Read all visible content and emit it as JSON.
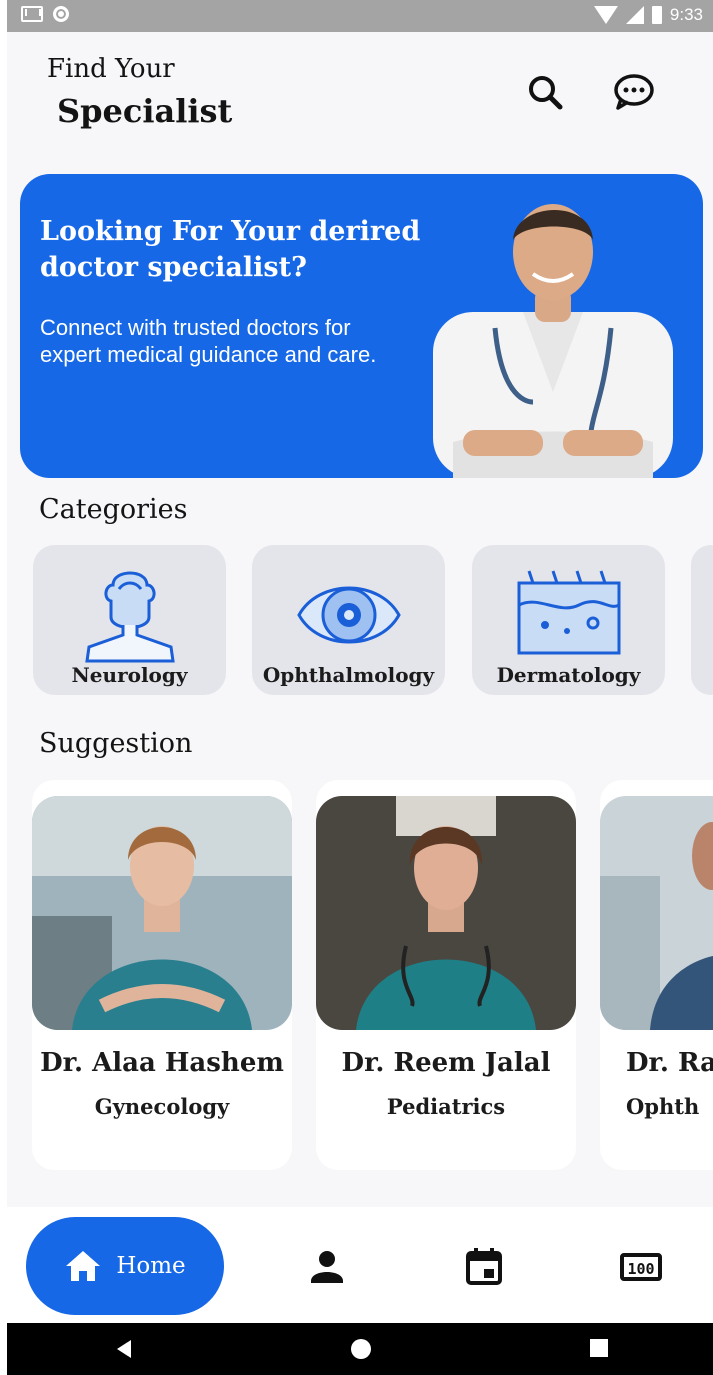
{
  "status_bar": {
    "time": "9:33",
    "icons": [
      "gmail-icon",
      "notification-circle-icon",
      "wifi-icon",
      "signal-icon",
      "battery-icon"
    ]
  },
  "header": {
    "line1": "Find Your",
    "line2": "Specialist",
    "icons": [
      "search-icon",
      "chat-icon"
    ]
  },
  "banner": {
    "title": "Looking For Your derired doctor specialist?",
    "subtitle": "Connect with trusted doctors for expert medical guidance and care."
  },
  "categories": {
    "title": "Categories",
    "items": [
      {
        "label": "Neurology",
        "icon": "brain-head-icon"
      },
      {
        "label": "Ophthalmology",
        "icon": "eye-icon"
      },
      {
        "label": "Dermatology",
        "icon": "skin-layers-icon"
      }
    ]
  },
  "suggestion": {
    "title": "Suggestion",
    "doctors": [
      {
        "name": "Dr. Alaa Hashem",
        "specialty": "Gynecology"
      },
      {
        "name": "Dr. Reem Jalal",
        "specialty": "Pediatrics"
      },
      {
        "name": "Dr. Ra",
        "specialty": "Ophth"
      }
    ]
  },
  "bottom_nav": {
    "home_label": "Home",
    "items": [
      "home-icon",
      "profile-icon",
      "calendar-icon",
      "counter-icon"
    ]
  },
  "colors": {
    "primary": "#1668e6",
    "background": "#f7f6f8",
    "card": "#e4e5ea"
  }
}
